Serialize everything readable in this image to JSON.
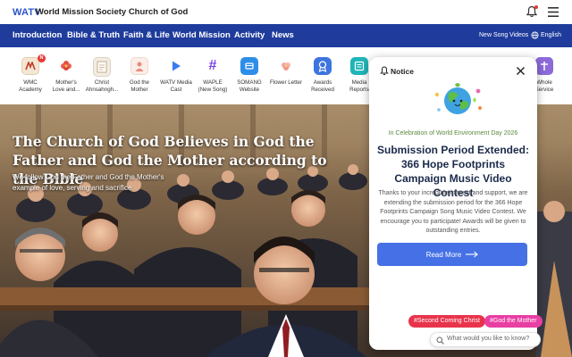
{
  "header": {
    "logo": "WATV",
    "site_title": "World Mission Society Church of God"
  },
  "nav": {
    "items": [
      "Introduction",
      "Bible & Truth",
      "Faith & Life",
      "World Mission",
      "Activity",
      "News"
    ],
    "new_song": "New Song",
    "videos": "Videos",
    "language": "English"
  },
  "quick_menu": {
    "items": [
      {
        "label": "WMC\nAcademy",
        "icon": "wmc-academy-icon",
        "badge": "N"
      },
      {
        "label": "Mother's\nLove and...",
        "icon": "flower-icon"
      },
      {
        "label": "Christ\nAhnsahngh...",
        "icon": "book-icon"
      },
      {
        "label": "God the\nMother",
        "icon": "mother-icon"
      },
      {
        "label": "WATV Media\nCast",
        "icon": "play-icon"
      },
      {
        "label": "WAPLE\n(New Song)",
        "icon": "hash-icon"
      },
      {
        "label": "SOMANG\nWebsite",
        "icon": "somang-icon"
      },
      {
        "label": "Flower Letter",
        "icon": "flower-letter-icon"
      },
      {
        "label": "Awards\nReceived",
        "icon": "medal-icon"
      },
      {
        "label": "Media\nReports",
        "icon": "media-icon"
      },
      {
        "label": "Whole\nService",
        "icon": "service-icon"
      }
    ]
  },
  "hero": {
    "title": "The Church of God Believes in God the Father and God the Mother according to the Bible",
    "subtitle": "We follow God the Father and God the Mother's example of love, serving and sacrifice."
  },
  "notice": {
    "title": "Notice",
    "kicker": "In Celebration of World Environment Day 2026",
    "headline": "Submission Period Extended: 366 Hope Footprints Campaign Music Video Contest",
    "body": "Thanks to your incredible interest and support, we are extending the submission period for the 366 Hope Footprints Campaign Song Music Video Contest. We encourage you to participate! Awards will be given to outstanding entries.",
    "button": "Read More"
  },
  "tags": [
    "#Second Coming Christ",
    "#God the Mother"
  ],
  "ask": {
    "placeholder": "What would you like to know?"
  },
  "colors": {
    "nav": "#1f3c9c",
    "brand": "#2b56c5",
    "button": "#4570e6",
    "tag1": "#e8344b",
    "tag2": "#e83fa3"
  }
}
